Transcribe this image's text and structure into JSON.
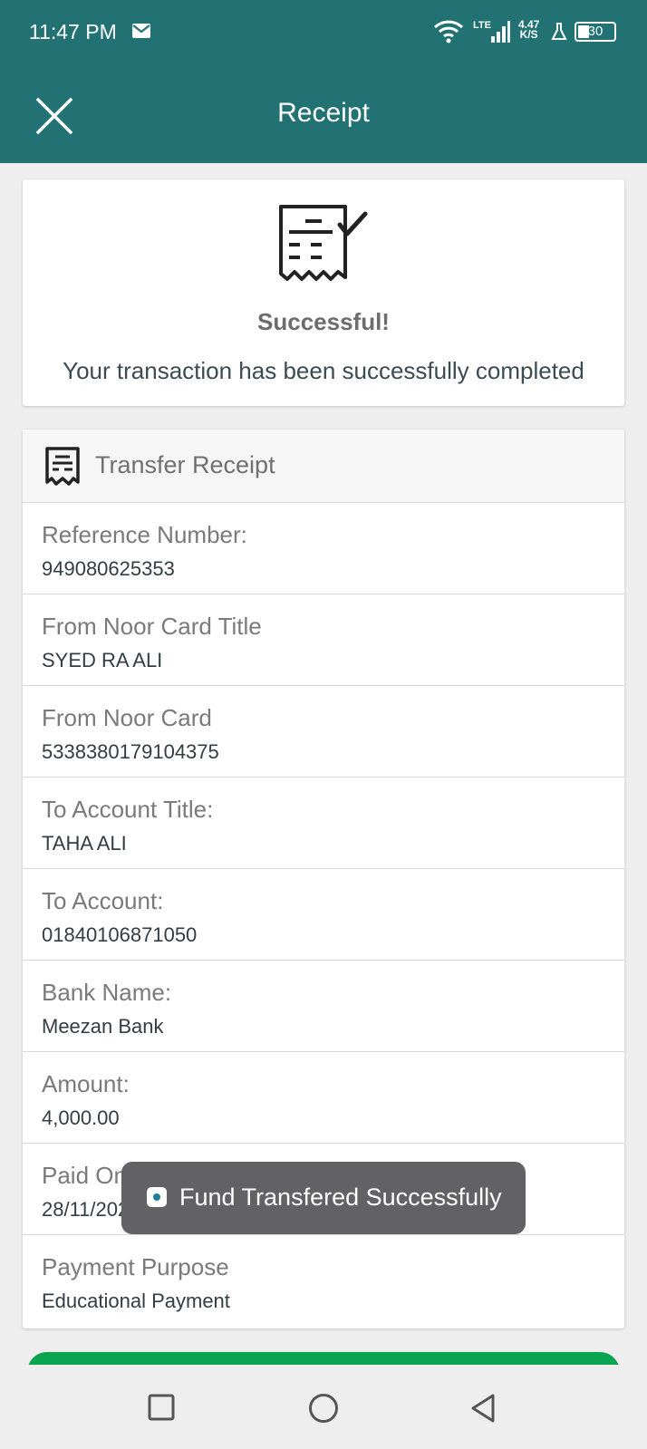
{
  "status_bar": {
    "time": "11:47 PM",
    "network": "LTE",
    "speed_value": "4.47",
    "speed_unit": "K/S",
    "battery": "30",
    "icons": [
      "mail-icon",
      "wifi-icon",
      "signal-icon",
      "flask-icon",
      "battery-icon"
    ]
  },
  "header": {
    "title": "Receipt",
    "close_icon": "close-icon"
  },
  "success": {
    "icon": "receipt-check-icon",
    "title": "Successful!",
    "message": "Your transaction has been successfully completed"
  },
  "receipt": {
    "title": "Transfer Receipt",
    "icon": "receipt-icon",
    "rows": [
      {
        "label": "Reference Number:",
        "value": "949080625353"
      },
      {
        "label": "From Noor Card Title",
        "value": "SYED RA ALI"
      },
      {
        "label": "From Noor Card",
        "value": "5338380179104375"
      },
      {
        "label": "To Account Title:",
        "value": "TAHA ALI"
      },
      {
        "label": "To Account:",
        "value": "01840106871050"
      },
      {
        "label": "Bank Name:",
        "value": "Meezan Bank"
      },
      {
        "label": "Amount:",
        "value": "4,000.00"
      },
      {
        "label": "Paid On:",
        "value": "28/11/2024"
      },
      {
        "label": "Payment Purpose",
        "value": "Educational Payment"
      }
    ]
  },
  "toast": {
    "message": "Fund Transfered Successfully"
  },
  "nav": {
    "icons": [
      "recent-apps-icon",
      "home-icon",
      "back-icon"
    ]
  },
  "colors": {
    "header": "#227274",
    "button": "#0aa34f",
    "toast": "#616166"
  }
}
